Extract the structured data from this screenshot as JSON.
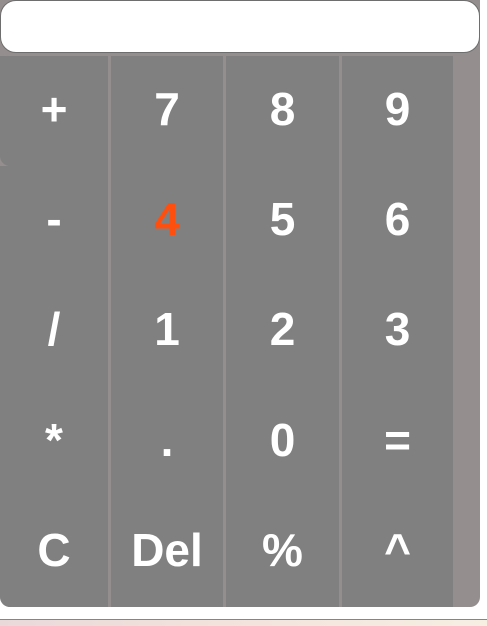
{
  "display": {
    "value": "",
    "placeholder": ""
  },
  "keys": [
    {
      "label": "+",
      "name": "add-button"
    },
    {
      "label": "7",
      "name": "digit-7-button"
    },
    {
      "label": "8",
      "name": "digit-8-button"
    },
    {
      "label": "9",
      "name": "digit-9-button"
    },
    {
      "label": "-",
      "name": "subtract-button"
    },
    {
      "label": "4",
      "name": "digit-4-button"
    },
    {
      "label": "5",
      "name": "digit-5-button"
    },
    {
      "label": "6",
      "name": "digit-6-button"
    },
    {
      "label": "/",
      "name": "divide-button"
    },
    {
      "label": "1",
      "name": "digit-1-button"
    },
    {
      "label": "2",
      "name": "digit-2-button"
    },
    {
      "label": "3",
      "name": "digit-3-button"
    },
    {
      "label": "*",
      "name": "multiply-button"
    },
    {
      "label": ".",
      "name": "decimal-button"
    },
    {
      "label": "0",
      "name": "digit-0-button"
    },
    {
      "label": "=",
      "name": "equals-button"
    },
    {
      "label": "C",
      "name": "clear-button"
    },
    {
      "label": "Del",
      "name": "delete-button"
    },
    {
      "label": "%",
      "name": "percent-button"
    },
    {
      "label": "^",
      "name": "power-button"
    }
  ],
  "highlighted_key": "4",
  "colors": {
    "key_background": "#808080",
    "key_text": "#ffffff",
    "highlight_text": "#ff4f0f",
    "body_background": "#948e8e"
  }
}
